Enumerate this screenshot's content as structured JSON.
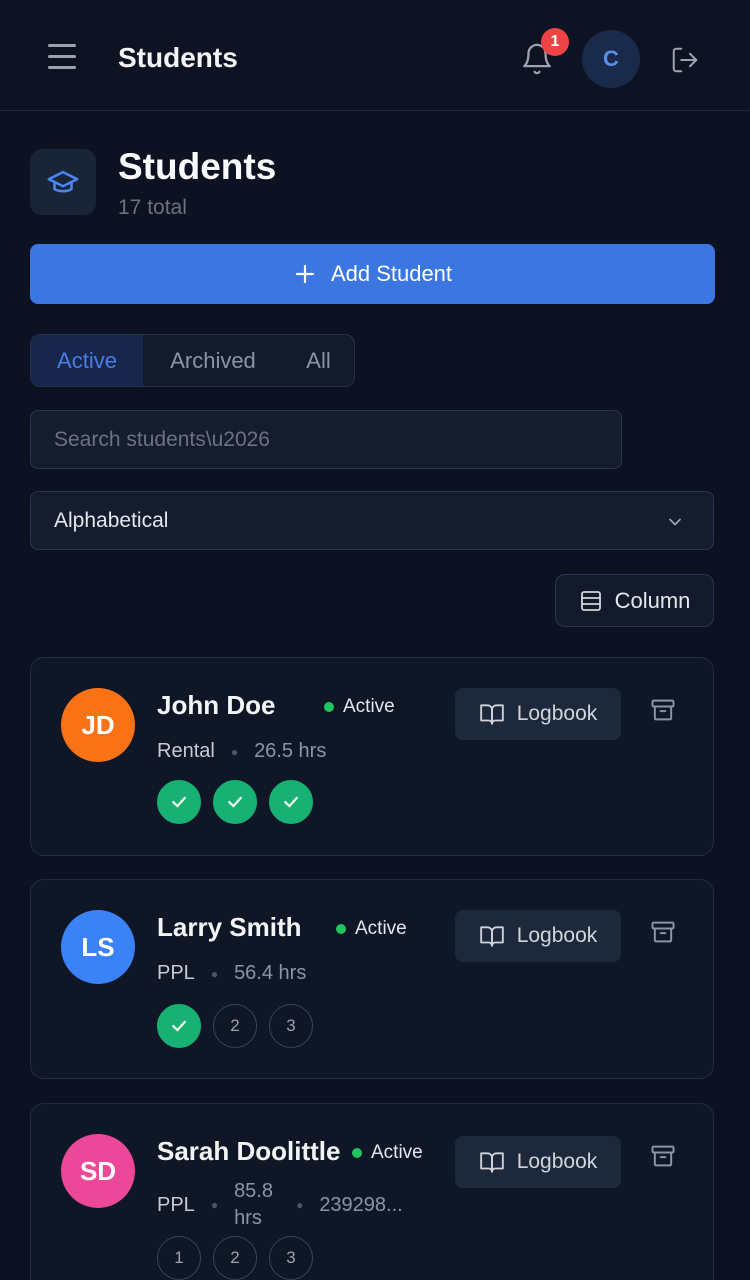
{
  "app": {
    "title": "Students",
    "notification_count": "1",
    "user_initial": "C"
  },
  "header": {
    "title": "Students",
    "subtitle": "17 total"
  },
  "actions": {
    "add_label": "Add Student",
    "column_label": "Column"
  },
  "tabs": [
    {
      "label": "Active",
      "active": true
    },
    {
      "label": "Archived",
      "active": false
    },
    {
      "label": "All",
      "active": false
    }
  ],
  "search": {
    "placeholder": "Search students\\u2026",
    "value": ""
  },
  "sort": {
    "selected": "Alphabetical"
  },
  "students": [
    {
      "initials": "JD",
      "name": "John Doe",
      "status": "Active",
      "type": "Rental",
      "hours": "26.5 hrs",
      "extra": "",
      "avatar_color": "#f97316",
      "steps": [
        {
          "label": "1",
          "done": true
        },
        {
          "label": "2",
          "done": true
        },
        {
          "label": "3",
          "done": true
        }
      ],
      "logbook_label": "Logbook"
    },
    {
      "initials": "LS",
      "name": "Larry Smith",
      "status": "Active",
      "type": "PPL",
      "hours": "56.4 hrs",
      "extra": "",
      "avatar_color": "#3b82f6",
      "steps": [
        {
          "label": "1",
          "done": true
        },
        {
          "label": "2",
          "done": false
        },
        {
          "label": "3",
          "done": false
        }
      ],
      "logbook_label": "Logbook"
    },
    {
      "initials": "SD",
      "name": "Sarah Doolittle",
      "status": "Active",
      "type": "PPL",
      "hours": "85.8 hrs",
      "extra": "239298...",
      "avatar_color": "#ec4899",
      "steps": [
        {
          "label": "1",
          "done": false
        },
        {
          "label": "2",
          "done": false
        },
        {
          "label": "3",
          "done": false
        }
      ],
      "logbook_label": "Logbook"
    }
  ]
}
